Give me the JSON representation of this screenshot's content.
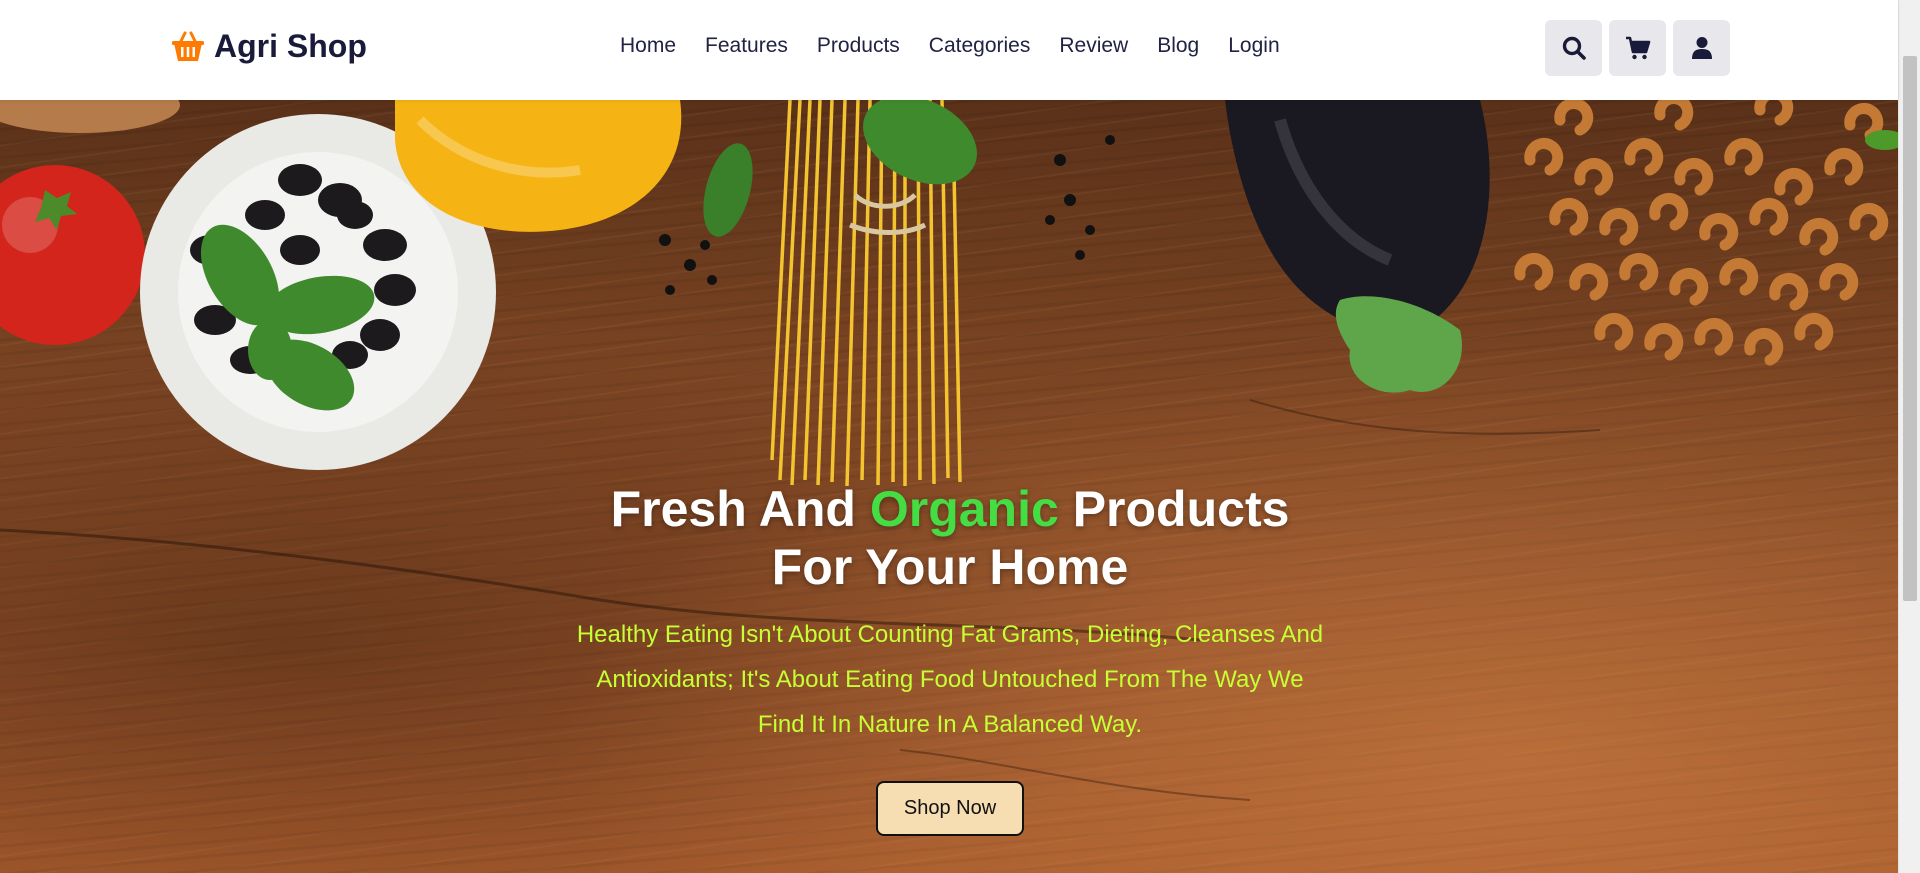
{
  "brand": {
    "name": "Agri Shop",
    "icon": "basket-icon",
    "icon_color": "#ff7a00"
  },
  "nav": [
    {
      "label": "Home"
    },
    {
      "label": "Features"
    },
    {
      "label": "Products"
    },
    {
      "label": "Categories"
    },
    {
      "label": "Review"
    },
    {
      "label": "Blog"
    },
    {
      "label": "Login"
    }
  ],
  "actions": [
    {
      "icon": "search-icon"
    },
    {
      "icon": "cart-icon"
    },
    {
      "icon": "user-icon"
    }
  ],
  "hero": {
    "title_part1": "Fresh And ",
    "title_accent": "Organic",
    "title_part2": " Products",
    "title_line2": "For Your Home",
    "subtitle": "Healthy Eating Isn't About Counting Fat Grams, Dieting, Cleanses And Antioxidants; It's About Eating Food Untouched From The Way We Find It In Nature In A Balanced Way.",
    "cta": "Shop Now"
  },
  "colors": {
    "accent_green": "#44dd44",
    "subtitle_lime": "#c6ff33",
    "cta_bg": "#f6deb2",
    "dark_text": "#1a1a3a"
  }
}
